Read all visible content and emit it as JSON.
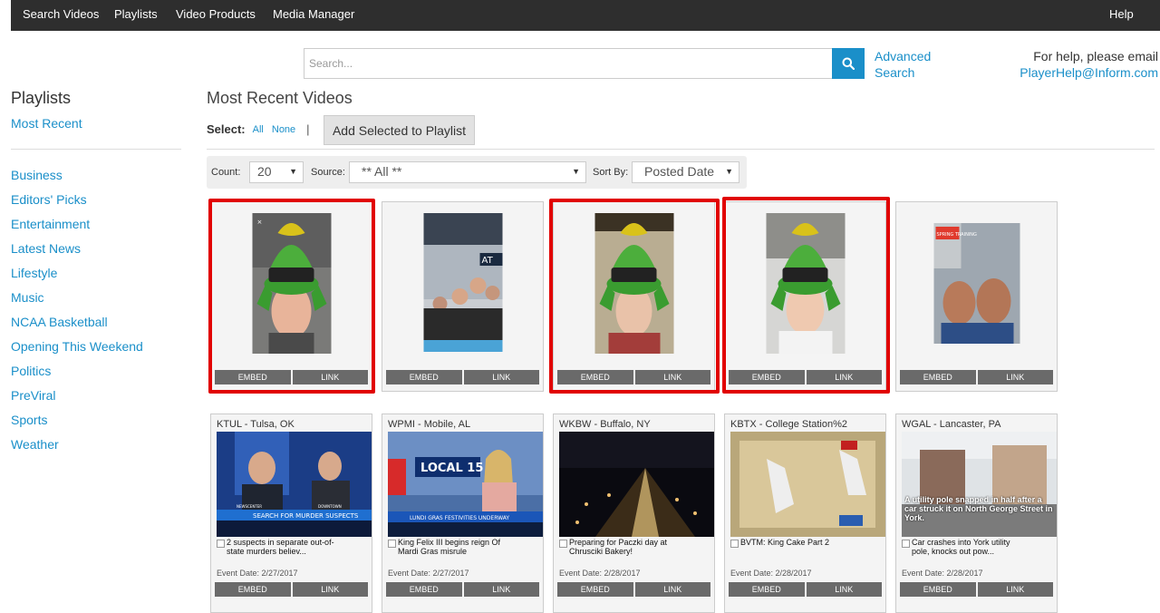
{
  "nav": {
    "items": [
      "Search Videos",
      "Playlists",
      "Video Products",
      "Media Manager"
    ],
    "help": "Help"
  },
  "search": {
    "placeholder": "Search...",
    "advanced_line1": "Advanced",
    "advanced_line2": "Search"
  },
  "helpbox": {
    "line1": "For help, please email",
    "line2": "PlayerHelp@Inform.com"
  },
  "sidebar": {
    "title": "Playlists",
    "top_item": "Most Recent",
    "items": [
      "Business",
      "Editors' Picks",
      "Entertainment",
      "Latest News",
      "Lifestyle",
      "Music",
      "NCAA Basketball",
      "Opening This Weekend",
      "Politics",
      "PreViral",
      "Sports",
      "Weather"
    ]
  },
  "main": {
    "title": "Most Recent Videos",
    "select_label": "Select:",
    "all": "All",
    "none": "None",
    "pipe": "|",
    "add_button": "Add Selected to Playlist"
  },
  "filters": {
    "count_label": "Count:",
    "count_value": "20",
    "source_label": "Source:",
    "source_value": "** All **",
    "sort_label": "Sort By:",
    "sort_value": "Posted Date"
  },
  "buttons": {
    "embed": "EMBED",
    "link": "LINK"
  },
  "row1_cards": [
    {
      "thumb": "snapchat-selfie-marvin-hat",
      "highlighted": true
    },
    {
      "thumb": "stadium-group-selfie",
      "highlighted": false
    },
    {
      "thumb": "snapchat-selfie-marvin-hat",
      "highlighted": true
    },
    {
      "thumb": "snapchat-selfie-marvin-hat",
      "highlighted": true
    },
    {
      "thumb": "spring-training-selfie",
      "highlighted": false
    }
  ],
  "row2_cards": [
    {
      "source": "KTUL - Tulsa, OK",
      "title": "2 suspects in separate out-of-state murders believ...",
      "date": "Event Date: 2/27/2017"
    },
    {
      "source": "WPMI - Mobile, AL",
      "title": "King Felix III begins reign Of Mardi Gras misrule",
      "date": "Event Date: 2/27/2017"
    },
    {
      "source": "WKBW - Buffalo, NY",
      "title": "Preparing for Paczki day at Chrusciki Bakery!",
      "date": "Event Date: 2/28/2017"
    },
    {
      "source": "KBTX - College Station%2",
      "title": "BVTM: King Cake Part 2",
      "date": "Event Date: 2/28/2017"
    },
    {
      "source": "WGAL - Lancaster, PA",
      "title": "Car crashes into York utility pole, knocks out pow...",
      "date": "Event Date: 2/28/2017"
    }
  ],
  "thumb_text": {
    "ktul_banner": "SEARCH FOR MURDER SUSPECTS",
    "ktul_tag1": "NEWSCENTER",
    "ktul_tag2": "DOWNTOWN",
    "wpmi_logo": "LOCAL 15",
    "wpmi_lower": "LUNDI GRAS FESTIVITIES UNDERWAY",
    "wgal_caption": "A utility pole snapped in half after a car struck it on North George Street in York.",
    "spring": "SPRING TRAINING",
    "yankees": "AT"
  },
  "colors": {
    "nav_bg": "#2e2e2e",
    "accent": "#1a8fc9",
    "highlight": "#e10000",
    "action_btn": "#6a6a6a"
  }
}
